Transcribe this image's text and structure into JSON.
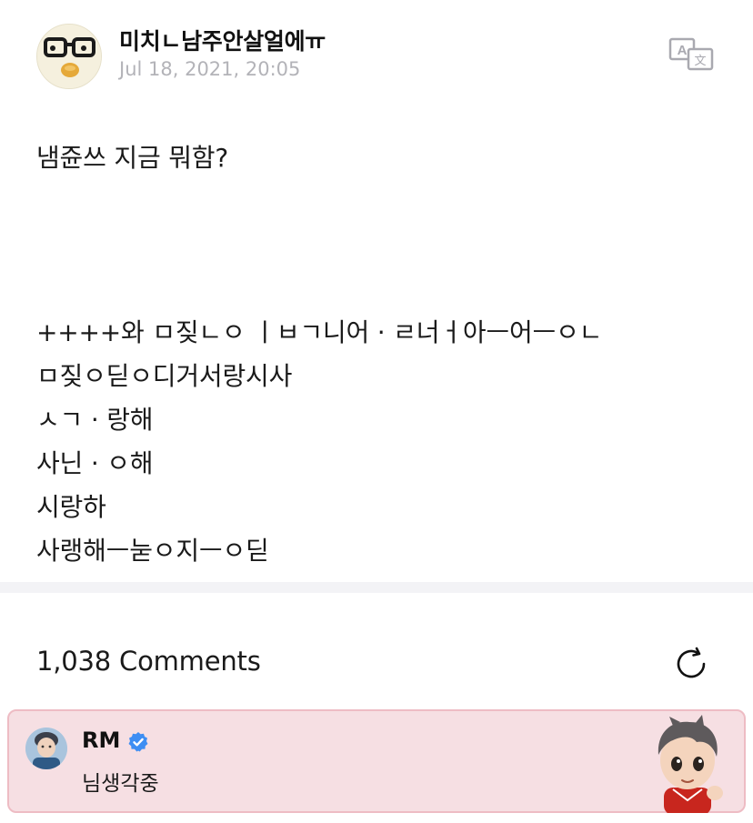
{
  "post": {
    "author": "미치ㄴ남주안살얼에ㅠ",
    "timestamp": "Jul 18, 2021, 20:05",
    "translate_icon": "translate-icon",
    "lines": [
      "냄쥰쓰 지금 뭐함?",
      "++++와 ㅁ짖ㄴㅇ ㅣㅂㄱ니어 · ㄹ너ㅓ아ㅡ어ㅡㅇㄴ",
      "ㅁ짖ㅇ딛ㅇ디거서랑시사",
      "ㅅㄱ · 랑해",
      "사닌 · ㅇ해",
      "시랑하",
      "사랭해ㅡ눋ㅇ지ㅡㅇ딛"
    ]
  },
  "comments": {
    "count_label": "1,038 Comments",
    "refresh_icon": "refresh-icon"
  },
  "featured_comment": {
    "author": "RM",
    "text": "님생각중",
    "verified_icon": "verified-badge-icon",
    "sticker": "character-sticker",
    "background_color": "#f6dfe3"
  }
}
